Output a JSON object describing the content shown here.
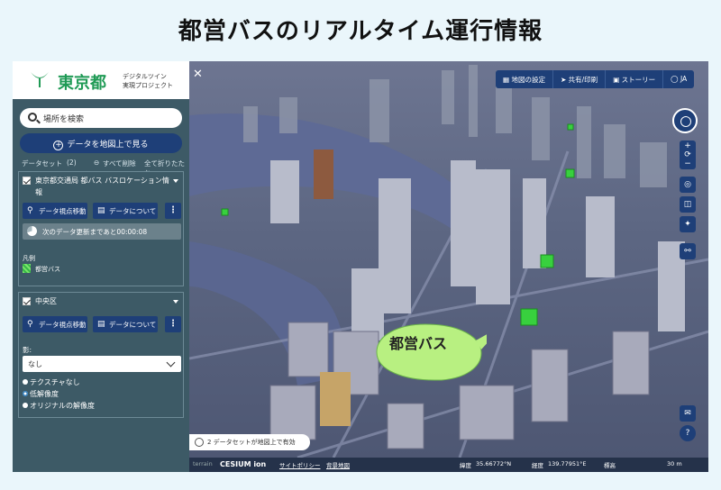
{
  "headline": "都営バスのリアルタイム運行情報",
  "brand": {
    "name": "東京都",
    "subtitle_line1": "デジタルツイン",
    "subtitle_line2": "実現プロジェクト"
  },
  "sidebar": {
    "search_placeholder": "場所を検索",
    "show_on_map": "データを地図上で見る",
    "dataset_label": "データセット",
    "dataset_count": "(2)",
    "clear_all": "すべて削除",
    "collapse_all": "全て折りたたむ",
    "card1": {
      "title": "東京都交通局 都バス バスロケーション情報",
      "move_button": "データ視点移動",
      "about_button": "データについて",
      "update_text": "次のデータ更新まであと00:00:08",
      "legend_heading": "凡例",
      "legend_item": "都営バス"
    },
    "card2": {
      "title": "中央区",
      "move_button": "データ視点移動",
      "about_button": "データについて",
      "shadow_label": "影:",
      "shadow_value": "なし",
      "options": [
        "テクスチャなし",
        "低解像度",
        "オリジナルの解像度"
      ]
    }
  },
  "toolbar": {
    "map_settings": "地図の設定",
    "share_print": "共有/印刷",
    "story": "ストーリー",
    "language": "JA"
  },
  "map": {
    "callout": "都営バス",
    "notice": "2 データセットが地図上で有効"
  },
  "footer": {
    "terrain_label": "terrain",
    "cesium": "CESIUM ion",
    "site_policy": "サイトポリシー",
    "terms": "背景地図",
    "lat_label": "緯度",
    "lat": "35.66772°N",
    "lon_label": "経度",
    "lon": "139.77951°E",
    "elev_label": "標高",
    "scale": "30 m"
  },
  "colors": {
    "sidebar_bg": "#3d5a66",
    "button_bg": "#1e3f78",
    "bus_marker": "#38b948",
    "callout": "#b8f081"
  }
}
